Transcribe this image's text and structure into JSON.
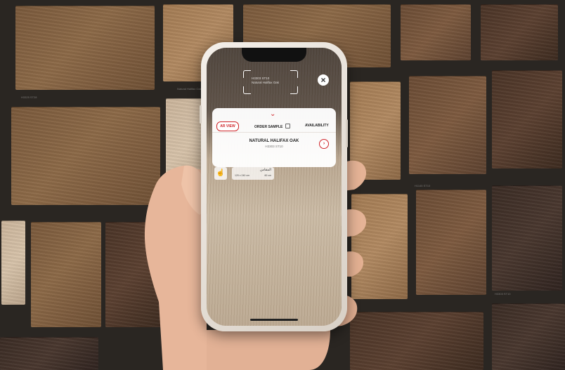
{
  "scene": {
    "tile_captions": [
      "H3325 ST28",
      "Natural Halifax Oak",
      "H1145 ST10",
      "H3303 ST10"
    ]
  },
  "ar_overlay": {
    "detected_code": "H3303 ST10",
    "detected_name": "Natural Halifax Oak",
    "close_icon": "close-icon"
  },
  "sheet": {
    "chevron_icon": "chevron-down-icon",
    "tabs": {
      "ar_view": "AR VIEW",
      "order_sample": "ORDER SAMPLE",
      "order_icon": "info-icon",
      "availability": "AVAILABILITY"
    },
    "product": {
      "name": "NATURAL HALIFAX OAK",
      "code": "H3303 ST10",
      "next_icon": "chevron-right-icon"
    }
  },
  "tools": {
    "gesture_icon": "hand-gesture-icon",
    "size_label_ar": "المقاس",
    "size_a": "120 x 240 cm",
    "size_b": "60 cm"
  },
  "colors": {
    "accent": "#d0262b",
    "sheet_bg": "#ffffff"
  }
}
